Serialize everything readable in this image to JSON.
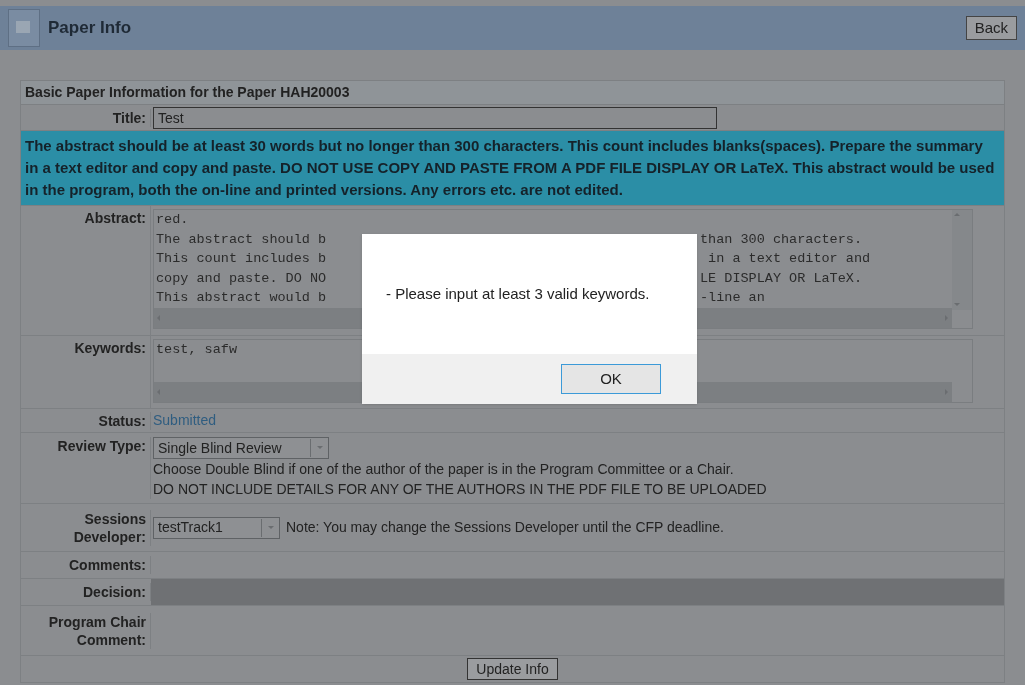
{
  "header": {
    "title": "Paper Info",
    "back_button": "Back"
  },
  "form": {
    "heading": "Basic Paper Information for the Paper HAH20003",
    "title_label": "Title:",
    "title_value": "Test",
    "notice": "The abstract should be at least 30 words but no longer than 300 characters. This count includes blanks(spaces). Prepare the summary in a text editor and copy and paste. DO NOT USE COPY AND PASTE FROM A PDF FILE DISPLAY OR LaTeX. This abstract would be used in the program, both the on-line and printed versions. Any errors etc. are not edited.",
    "abstract_label": "Abstract:",
    "abstract_lines": [
      {
        "left": "red."
      },
      {
        "left": "The abstract should b",
        "right": "than 300 characters."
      },
      {
        "left": "This count includes b",
        "right": " in a text editor and"
      },
      {
        "left": "copy and paste. DO NO",
        "right": "LE DISPLAY OR LaTeX."
      },
      {
        "left": "This abstract would b",
        "right": "-line an"
      }
    ],
    "keywords_label": "Keywords:",
    "keywords_value": "test, safw",
    "status_label": "Status:",
    "status_value": "Submitted",
    "review_label": "Review Type:",
    "review_value": "Single Blind Review",
    "review_notes": [
      "Choose Double Blind if one of the author of the paper is in the Program Committee or a Chair.",
      "DO NOT INCLUDE DETAILS FOR ANY OF THE AUTHORS IN THE PDF FILE TO BE UPLOADED"
    ],
    "sessions_label": "Sessions Developer:",
    "sessions_value": "testTrack1",
    "sessions_note": "Note: You may change the Sessions Developer until the CFP deadline.",
    "comments_label": "Comments:",
    "decision_label": "Decision:",
    "chair_label": "Program Chair Comment:",
    "submit_button": "Update Info"
  },
  "dialog": {
    "message": "- Please input at least 3 valid keywords.",
    "ok_button": "OK"
  }
}
